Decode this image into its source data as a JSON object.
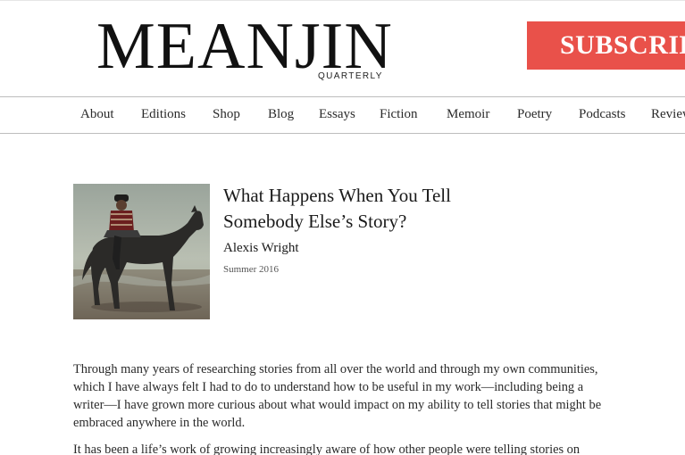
{
  "header": {
    "logo_title": "MEANJIN",
    "logo_subtitle": "QUARTERLY",
    "subscribe_label": "SUBSCRIBE",
    "colors": {
      "subscribe_bg": "#e9514a",
      "text": "#111111"
    }
  },
  "nav": {
    "items": [
      {
        "label": "About"
      },
      {
        "label": "Editions"
      },
      {
        "label": "Shop"
      },
      {
        "label": "Blog"
      },
      {
        "label": "Essays"
      },
      {
        "label": "Fiction"
      },
      {
        "label": "Memoir"
      },
      {
        "label": "Poetry"
      },
      {
        "label": "Podcasts"
      },
      {
        "label": "Reviews"
      }
    ]
  },
  "article": {
    "title": "What Happens When You Tell Somebody Else’s Story?",
    "author": "Alexis Wright",
    "issue": "Summer 2016",
    "image_icon": "horse-and-rider-image",
    "paragraphs": [
      "Through many years of researching stories from all over the world and through my own communities, which I have always felt I had to do to understand how to be useful in my work—including being a writer—I have grown more curious about what would impact on my ability to tell stories that might be embraced anywhere in the world.",
      "It has been a life’s work of growing increasingly aware of how other people were telling stories on"
    ]
  }
}
